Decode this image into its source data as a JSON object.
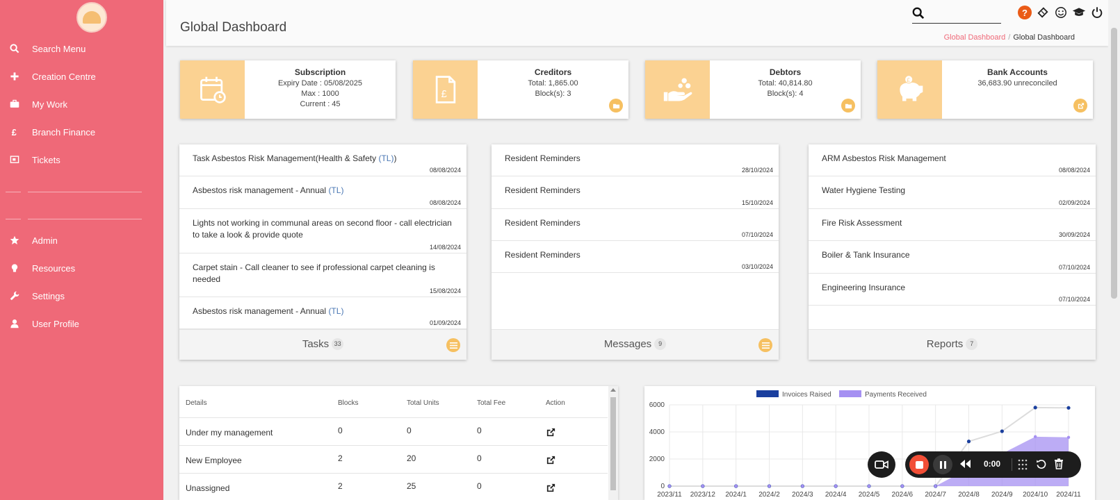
{
  "colors": {
    "sidebar": "#ef6978",
    "tile": "#fbd292",
    "accent": "#f6c061",
    "help": "#ea5b17",
    "invoices": "#1a3f9e",
    "payments": "#a590f2"
  },
  "sidebar": {
    "items": [
      {
        "label": "Search Menu",
        "icon": "search-icon"
      },
      {
        "label": "Creation Centre",
        "icon": "plus-icon"
      },
      {
        "label": "My Work",
        "icon": "briefcase-icon"
      },
      {
        "label": "Branch Finance",
        "icon": "pound-icon"
      },
      {
        "label": "Tickets",
        "icon": "ticket-icon"
      },
      {
        "label": "Admin",
        "icon": "star-icon"
      },
      {
        "label": "Resources",
        "icon": "lightbulb-icon"
      },
      {
        "label": "Settings",
        "icon": "wrench-icon"
      },
      {
        "label": "User Profile",
        "icon": "user-icon"
      }
    ]
  },
  "header": {
    "title": "Global Dashboard",
    "breadcrumb": [
      "Global Dashboard",
      "Global Dashboard"
    ],
    "search_placeholder": "",
    "help_label": "?"
  },
  "stats": [
    {
      "title": "Subscription",
      "lines": [
        "Expiry Date : 05/08/2025",
        "Max : 1000",
        "Current : 45"
      ],
      "icon": "calendar-icon"
    },
    {
      "title": "Creditors",
      "lines": [
        "Total: 1,865.00",
        "Block(s): 3"
      ],
      "icon": "invoice-icon"
    },
    {
      "title": "Debtors",
      "lines": [
        "Total: 40,814.80",
        "Block(s): 4"
      ],
      "icon": "hand-coins-icon"
    },
    {
      "title": "Bank Accounts",
      "lines": [
        "36,683.90 unreconciled"
      ],
      "icon": "piggy-bank-icon"
    }
  ],
  "tasks": {
    "title": "Tasks",
    "count": "33",
    "items": [
      {
        "text": "Task Asbestos Risk Management(Health & Safety ",
        "tag": "(TL)",
        "suffix": ")",
        "date": "08/08/2024"
      },
      {
        "text": "Asbestos risk management - Annual ",
        "tag": "(TL)",
        "suffix": "",
        "date": "08/08/2024"
      },
      {
        "text": "Lights not working in communal areas on second floor - call electrician to take a look & provide quote",
        "tag": "",
        "suffix": "",
        "date": "14/08/2024"
      },
      {
        "text": "Carpet stain - Call cleaner to see if professional carpet cleaning is needed",
        "tag": "",
        "suffix": "",
        "date": "15/08/2024"
      },
      {
        "text": "Asbestos risk management - Annual ",
        "tag": "(TL)",
        "suffix": "",
        "date": "01/09/2024"
      }
    ]
  },
  "messages": {
    "title": "Messages",
    "count": "9",
    "items": [
      {
        "text": "Resident Reminders",
        "date": "28/10/2024"
      },
      {
        "text": "Resident Reminders",
        "date": "15/10/2024"
      },
      {
        "text": "Resident Reminders",
        "date": "07/10/2024"
      },
      {
        "text": "Resident Reminders",
        "date": "03/10/2024"
      }
    ]
  },
  "reports": {
    "title": "Reports",
    "count": "7",
    "items": [
      {
        "text": "ARM Asbestos Risk Management",
        "date": "08/08/2024"
      },
      {
        "text": "Water Hygiene Testing",
        "date": "02/09/2024"
      },
      {
        "text": "Fire Risk Assessment",
        "date": "30/09/2024"
      },
      {
        "text": "Boiler & Tank Insurance",
        "date": "07/10/2024"
      },
      {
        "text": "Engineering Insurance",
        "date": "07/10/2024"
      }
    ]
  },
  "blocks_table": {
    "headers": [
      "Details",
      "Blocks",
      "Total Units",
      "Total Fee",
      "Action"
    ],
    "rows": [
      {
        "details": "Under my management",
        "blocks": "0",
        "units": "0",
        "fee": "0"
      },
      {
        "details": "New Employee",
        "blocks": "2",
        "units": "20",
        "fee": "0"
      },
      {
        "details": "Unassigned",
        "blocks": "2",
        "units": "25",
        "fee": "0"
      }
    ]
  },
  "recorder": {
    "time": "0:00"
  },
  "chart_data": {
    "type": "line",
    "categories": [
      "2023/11",
      "2023/12",
      "2024/1",
      "2024/2",
      "2024/3",
      "2024/4",
      "2024/5",
      "2024/6",
      "2024/7",
      "2024/8",
      "2024/9",
      "2024/10",
      "2024/11"
    ],
    "series": [
      {
        "name": "Invoices Raised",
        "values": [
          0,
          0,
          0,
          0,
          0,
          0,
          0,
          0,
          0,
          3300,
          4050,
          5800,
          5780
        ]
      },
      {
        "name": "Payments Received",
        "values": [
          0,
          0,
          0,
          0,
          0,
          0,
          0,
          0,
          0,
          1300,
          2400,
          3650,
          3600
        ]
      }
    ],
    "yticks": [
      0,
      2000,
      4000,
      6000
    ],
    "ylim": [
      0,
      6000
    ],
    "legend": "top",
    "grid": true
  }
}
